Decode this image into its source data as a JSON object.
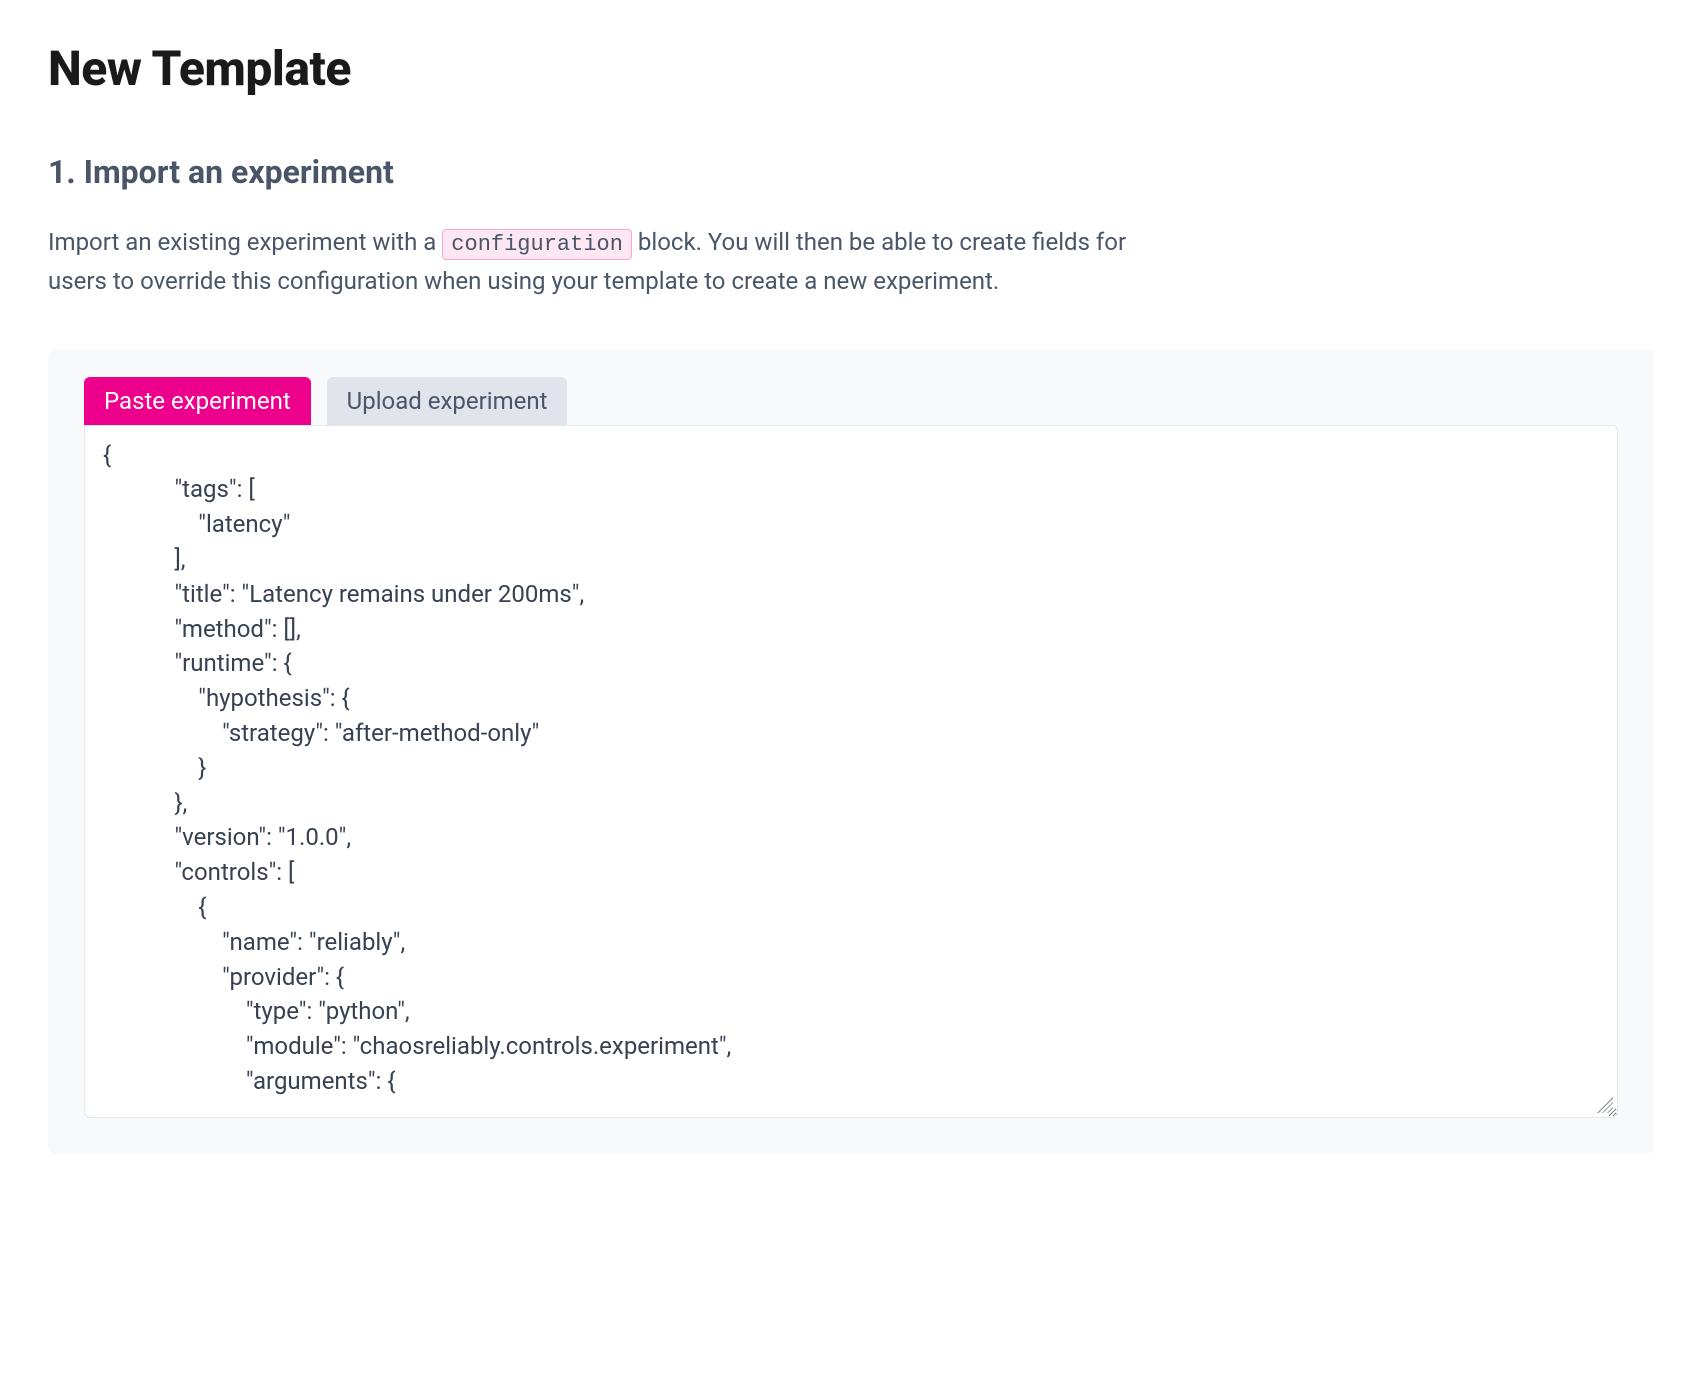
{
  "page": {
    "title": "New Template"
  },
  "section": {
    "title": "1. Import an experiment",
    "description_before": "Import an existing experiment with a ",
    "description_code": "configuration",
    "description_after": " block. You will then be able to create fields for users to override this configuration when using your template to create a new experiment."
  },
  "tabs": {
    "paste": "Paste experiment",
    "upload": "Upload experiment",
    "active": "paste"
  },
  "editor": {
    "content": "{\n            \"tags\": [\n                \"latency\"\n            ],\n            \"title\": \"Latency remains under 200ms\",\n            \"method\": [],\n            \"runtime\": {\n                \"hypothesis\": {\n                    \"strategy\": \"after-method-only\"\n                }\n            },\n            \"version\": \"1.0.0\",\n            \"controls\": [\n                {\n                    \"name\": \"reliably\",\n                    \"provider\": {\n                        \"type\": \"python\",\n                        \"module\": \"chaosreliably.controls.experiment\",\n                        \"arguments\": {"
  }
}
